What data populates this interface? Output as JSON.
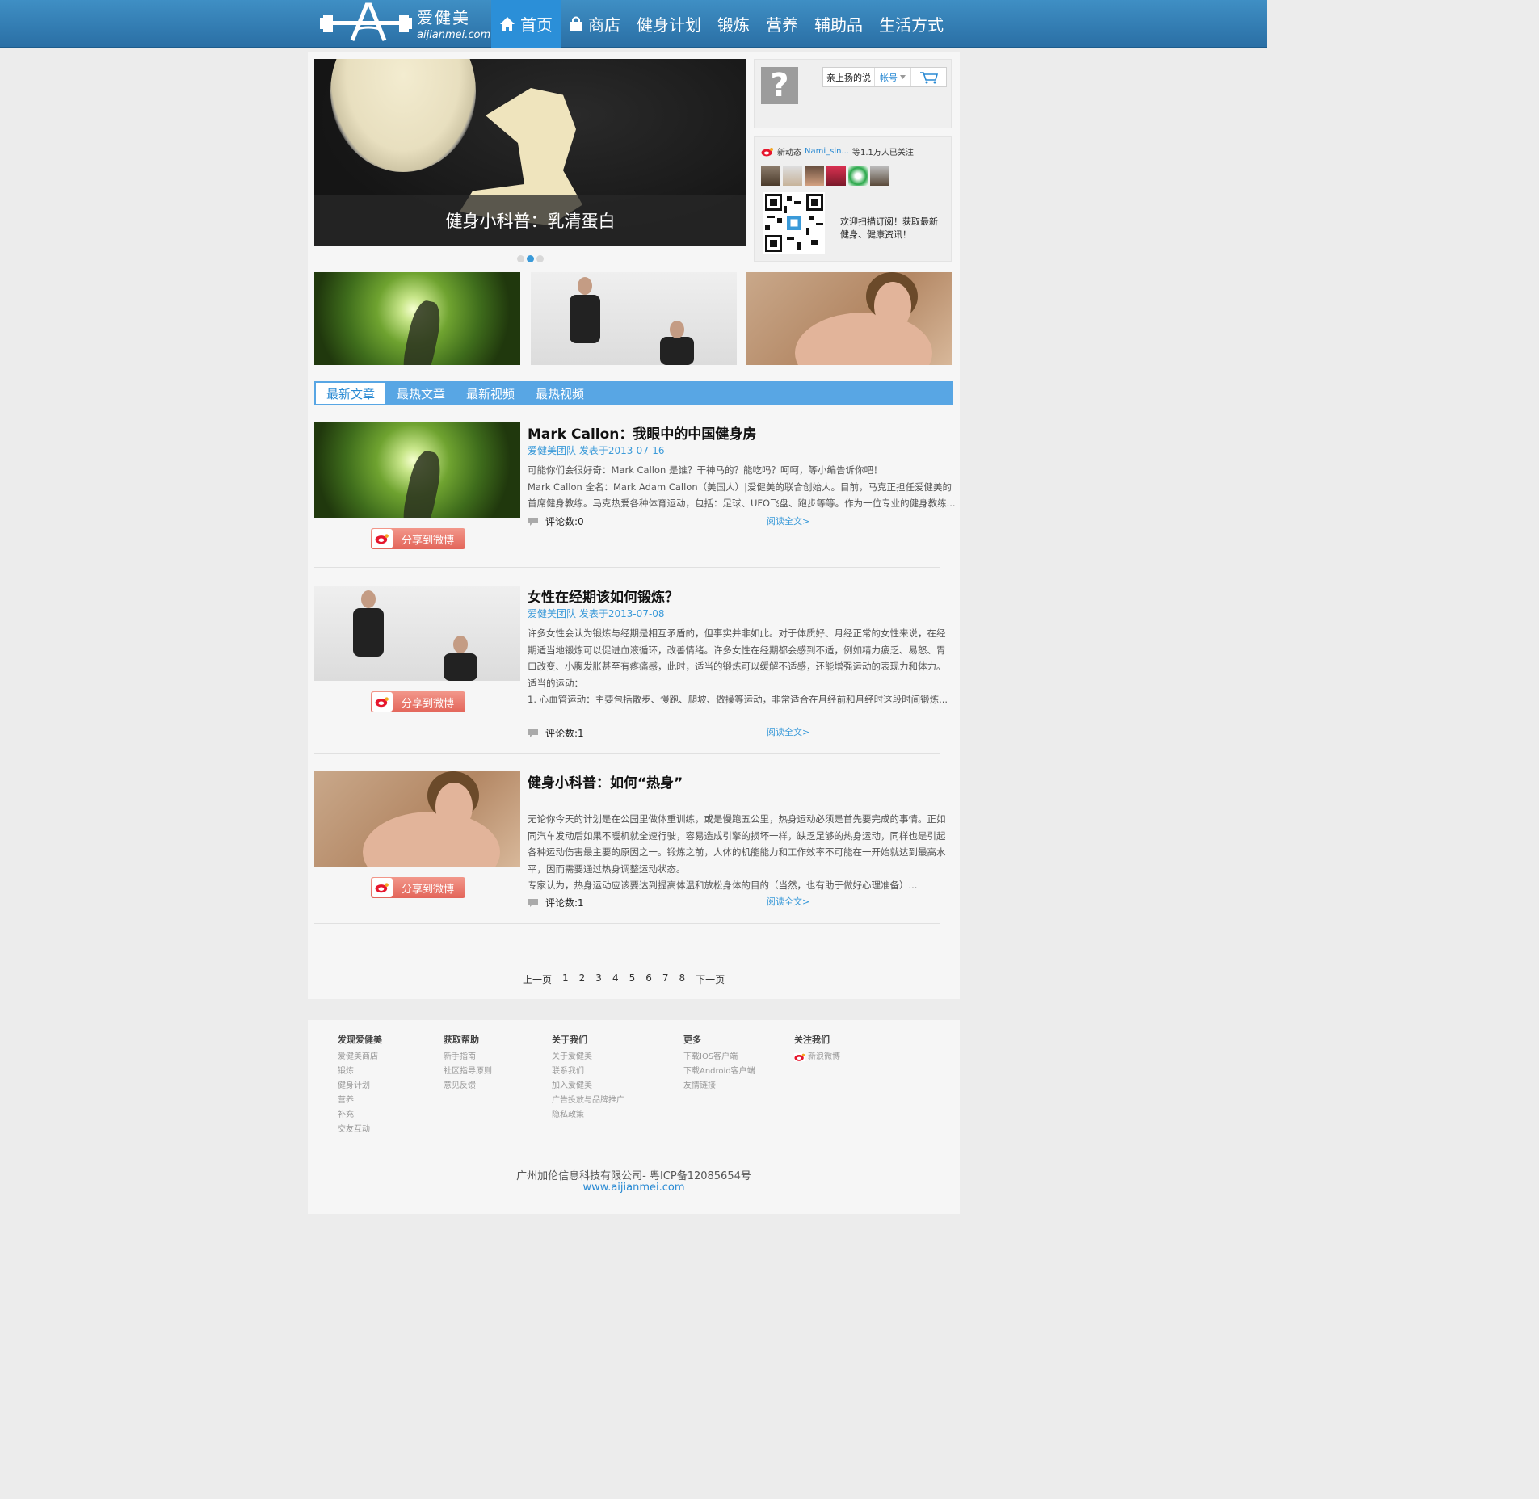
{
  "header": {
    "logo_cn": "爱健美",
    "logo_en": "aijianmei.com",
    "nav": [
      "首页",
      "商店",
      "健身计划",
      "锻炼",
      "营养",
      "辅助品",
      "生活方式"
    ]
  },
  "banner": {
    "caption": "健身小科普：乳清蛋白",
    "slide_count": 3,
    "active_slide": 2
  },
  "user": {
    "name": "亲上扬的说",
    "account": "帐号"
  },
  "weibo": {
    "label": "新动态",
    "user": "Nami_sin...",
    "followers": "等1.1万人已关注",
    "subscribe_text": "欢迎扫描订阅！获取最新健身、健康资讯！"
  },
  "tabs": [
    "最新文章",
    "最热文章",
    "最新视频",
    "最热视频"
  ],
  "share_label": "分享到微博",
  "articles": [
    {
      "title": "Mark Callon：我眼中的中国健身房",
      "meta": "爱健美团队  发表于2013-07-16",
      "body": [
        "可能你们会很好奇：Mark Callon 是谁？干神马的？能吃吗？呵呵，等小编告诉你吧！",
        "Mark Callon 全名：Mark Adam Callon（美国人）|爱健美的联合创始人。目前，马克正担任爱健美的",
        "首席健身教练。马克热爱各种体育运动，包括：足球、UFO飞盘、跑步等等。作为一位专业的健身教练..."
      ],
      "comments": "评论数:0",
      "read_more": "阅读全文>"
    },
    {
      "title": "女性在经期该如何锻炼？",
      "meta": "爱健美团队  发表于2013-07-08",
      "body": [
        "许多女性会认为锻炼与经期是相互矛盾的，但事实并非如此。对于体质好、月经正常的女性来说，在经",
        "期适当地锻炼可以促进血液循环，改善情绪。许多女性在经期都会感到不适，例如精力疲乏、易怒、胃",
        "口改变、小腹发胀甚至有疼痛感，此时，适当的锻炼可以缓解不适感，还能增强运动的表现力和体力。",
        "适当的运动：",
        "1. 心血管运动：主要包括散步、慢跑、爬坡、做操等运动，非常适合在月经前和月经时这段时间锻炼..."
      ],
      "comments": "评论数:1",
      "read_more": "阅读全文>"
    },
    {
      "title": "健身小科普：如何“热身”",
      "meta": "",
      "body": [
        "无论你今天的计划是在公园里做体重训练，或是慢跑五公里，热身运动必须是首先要完成的事情。正如",
        "同汽车发动后如果不暖机就全速行驶，容易造成引擎的损坏一样，缺乏足够的热身运动，同样也是引起",
        "各种运动伤害最主要的原因之一。锻炼之前，人体的机能能力和工作效率不可能在一开始就达到最高水",
        "平，因而需要通过热身调整运动状态。",
        "专家认为，热身运动应该要达到提高体温和放松身体的目的（当然，也有助于做好心理准备）..."
      ],
      "comments": "评论数:1",
      "read_more": "阅读全文>"
    }
  ],
  "pager": [
    "上一页",
    "1",
    "2",
    "3",
    "4",
    "5",
    "6",
    "7",
    "8",
    "下一页"
  ],
  "footer": {
    "columns": [
      {
        "title": "发现爱健美",
        "links": [
          "爱健美商店",
          "锻炼",
          "健身计划",
          "营养",
          "补充",
          "交友互动"
        ]
      },
      {
        "title": "获取帮助",
        "links": [
          "新手指南",
          "社区指导原则",
          "意见反馈"
        ]
      },
      {
        "title": "关于我们",
        "links": [
          "关于爱健美",
          "联系我们",
          "加入爱健美",
          "广告投放与品牌推广",
          "隐私政策"
        ]
      },
      {
        "title": "更多",
        "links": [
          "下载IOS客户端",
          "下载Android客户端",
          "友情链接"
        ]
      },
      {
        "title": "关注我们",
        "links": [
          "新浪微博"
        ]
      }
    ],
    "copyright": "广州加伦信息科技有限公司- 粤ICP备12085654号",
    "site": "www.aijianmei.com"
  },
  "colors": {
    "header": "#2a6fa5",
    "accent": "#3a9ad9",
    "tab_bar": "#58a6e4",
    "share": "#e3655a"
  },
  "icons": [
    "home-icon",
    "bag-icon",
    "cart-icon",
    "weibo-icon",
    "comment-icon",
    "qr-code"
  ]
}
